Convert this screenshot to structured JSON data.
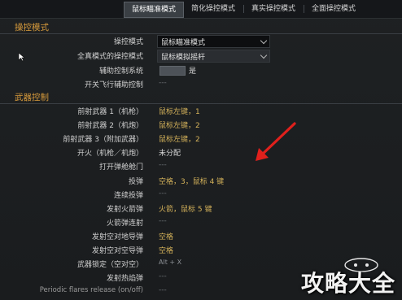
{
  "tabs": [
    {
      "label": "鼠标瞄准模式",
      "active": true
    },
    {
      "label": "简化操控模式",
      "active": false
    },
    {
      "label": "真实操控模式",
      "active": false
    },
    {
      "label": "全面操控模式",
      "active": false
    }
  ],
  "control_mode_section": {
    "title": "操控模式",
    "control_mode": {
      "label": "操控模式",
      "value": "鼠标瞄准模式"
    },
    "full_real_mode": {
      "label": "全真模式的操控模式",
      "value": "鼠标模拟摇杆"
    },
    "assist_system": {
      "label": "辅助控制系统",
      "value": "是"
    },
    "flight_assist_toggle": {
      "label": "开关飞行辅助控制",
      "value": "---"
    }
  },
  "weapons_section": {
    "title": "武器控制",
    "rows": [
      {
        "label": "前射武器 1（机枪）",
        "value": "鼠标左键，1",
        "style": "gold"
      },
      {
        "label": "前射武器 2（机炮）",
        "value": "鼠标左键，2",
        "style": "gold"
      },
      {
        "label": "前射武器 3（附加武器）",
        "value": "鼠标左键，2",
        "style": "gold"
      },
      {
        "label": "开火（机枪／机炮）",
        "value": "未分配",
        "style": "white"
      },
      {
        "label": "打开弹舱舱门",
        "value": "---",
        "style": "dash"
      },
      {
        "label": "投弹",
        "value": "空格，3，鼠标 4 键",
        "style": "gold"
      },
      {
        "label": "连续投弹",
        "value": "---",
        "style": "dash"
      },
      {
        "label": "发射火箭弹",
        "value": "火箭，鼠标 5 键",
        "style": "gold"
      },
      {
        "label": "火箭弹连射",
        "value": "---",
        "style": "dash"
      },
      {
        "label": "发射空对地导弹",
        "value": "空格",
        "style": "gold"
      },
      {
        "label": "发射空对空导弹",
        "value": "空格",
        "style": "gold"
      },
      {
        "label": "武器锁定（空对空）",
        "value": "Alt + X",
        "style": "small"
      },
      {
        "label": "发射热焰弹",
        "value": "---",
        "style": "dash"
      },
      {
        "label": "Periodic flares release (on/off)",
        "value": "---",
        "style": "dash",
        "label_style": "dim"
      }
    ]
  },
  "watermark": {
    "text": "攻略大全"
  },
  "colors": {
    "section_title": "#d89b3c",
    "bound_key": "#d4b25a",
    "annotation_arrow": "#e0201c",
    "background": "#1c1f21"
  },
  "icons": [
    "mouse-cursor-icon",
    "chevron-down-icon",
    "red-annotation-arrow"
  ]
}
